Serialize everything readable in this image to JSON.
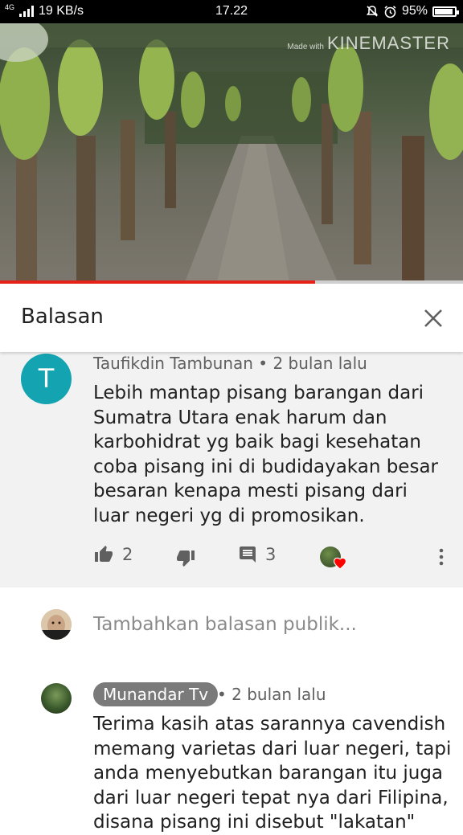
{
  "status_bar": {
    "network_type": "4G",
    "speed": "19 KB/s",
    "time": "17.22",
    "battery": "95%",
    "battery_fraction": 0.95
  },
  "video": {
    "watermark_prefix": "Made with",
    "watermark": "KINEMASTER",
    "progress_fraction": 0.68,
    "progress_color": "#e62117"
  },
  "replies_panel": {
    "title": "Balasan",
    "close_icon": "close-icon"
  },
  "comment": {
    "avatar_letter": "T",
    "avatar_color": "#14a3b1",
    "author": "Taufikdin Tambunan",
    "separator": "•",
    "time": "2 bulan lalu",
    "text": "Lebih mantap pisang barangan dari Sumatra Utara enak harum dan karbohidrat yg baik bagi kesehatan coba pisang ini di budidayakan besar besaran kenapa mesti pisang dari luar negeri yg di promosikan.",
    "likes": "2",
    "replies": "3",
    "icons": {
      "like": "thumb-up-icon",
      "dislike": "thumb-down-icon",
      "reply": "comment-icon",
      "creator_heart": "heart-icon",
      "more": "more-vert-icon"
    },
    "heart_color": "#ff0000"
  },
  "add_reply": {
    "placeholder": "Tambahkan balasan publik..."
  },
  "reply": {
    "author": "Munandar Tv",
    "separator": "•",
    "time": "2 bulan lalu",
    "text": "Terima kasih atas sarannya cavendish memang varietas dari luar  negeri, tapi anda menyebutkan barangan itu juga dari luar negeri tepat nya dari Filipina, disana pisang ini disebut \"lakatan\""
  }
}
